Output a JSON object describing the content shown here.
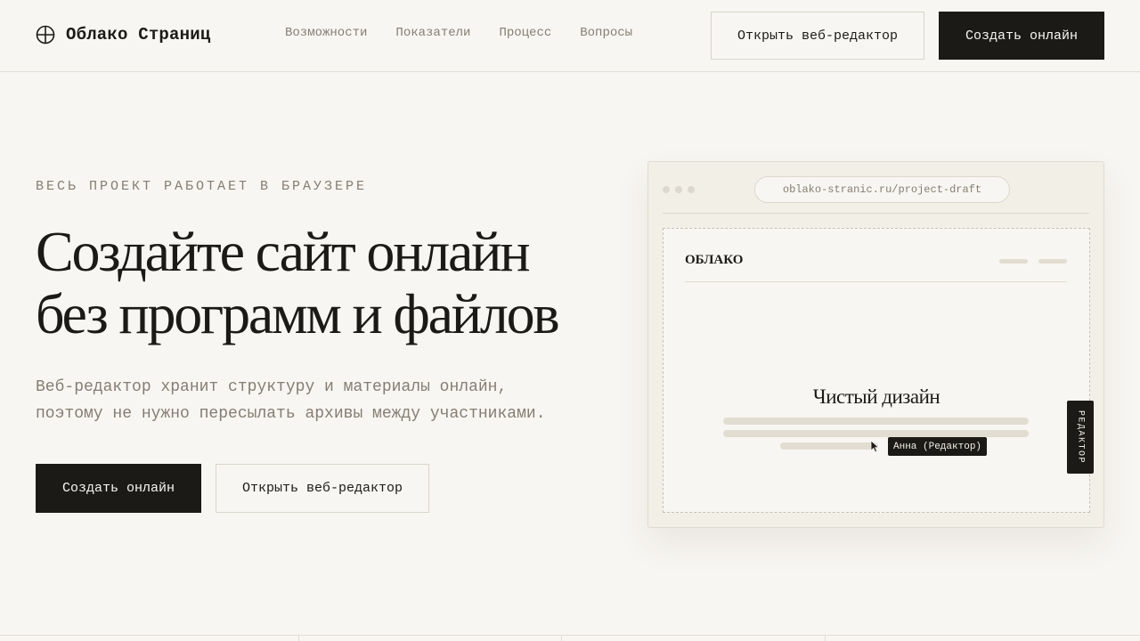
{
  "brand": {
    "name": "Облако Страниц",
    "icon": "globe-icon"
  },
  "nav": {
    "items": [
      {
        "label": "Возможности"
      },
      {
        "label": "Показатели"
      },
      {
        "label": "Процесс"
      },
      {
        "label": "Вопросы"
      }
    ]
  },
  "header": {
    "open_editor_label": "Открыть веб-редактор",
    "create_online_label": "Создать онлайн"
  },
  "hero": {
    "eyebrow": "ВЕСЬ ПРОЕКТ РАБОТАЕТ В БРАУЗЕРЕ",
    "headline_line1": "Создайте сайт онлайн",
    "headline_line2": "без программ и файлов",
    "subtext_line1": "Веб-редактор хранит структуру и материалы онлайн,",
    "subtext_line2": "поэтому не нужно пересылать архивы между участниками.",
    "create_online_label": "Создать онлайн",
    "open_editor_label": "Открыть веб-редактор"
  },
  "mockup": {
    "url": "oblako-stranic.ru/project-draft",
    "site_logo": "ОБЛАКО",
    "site_title": "Чистый дизайн",
    "cursor_label": "Анна (Редактор)",
    "editor_tab_label": "РЕДАКТОР"
  },
  "colors": {
    "background": "#f8f6f2",
    "ink": "#1c1a17",
    "muted": "#857d72",
    "panel": "#f2efe7",
    "border": "#e2ded6"
  }
}
